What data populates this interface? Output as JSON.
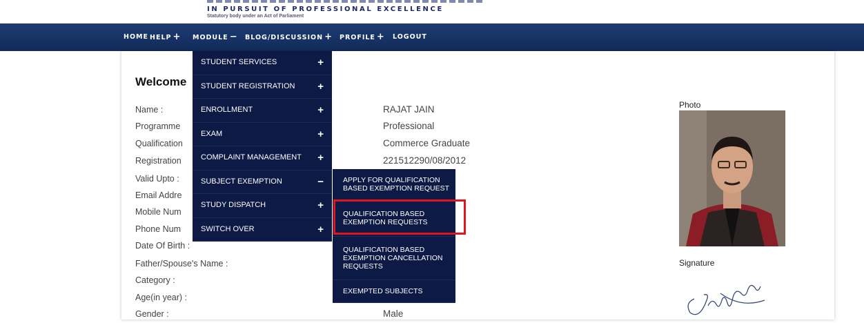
{
  "header": {
    "tagline": "IN PURSUIT OF PROFESSIONAL EXCELLENCE",
    "subtagline": "Statutory body under an Act of Parliament"
  },
  "nav": {
    "items": [
      {
        "label": "HOME",
        "sign": ""
      },
      {
        "label": "HELP",
        "sign": "+"
      },
      {
        "label": "MODULE",
        "sign": "−"
      },
      {
        "label": "BLOG/DISCUSSION",
        "sign": "+"
      },
      {
        "label": "PROFILE",
        "sign": "+"
      },
      {
        "label": "LOGOUT",
        "sign": ""
      }
    ]
  },
  "welcome": "Welcome",
  "fields": [
    {
      "label": "Name :",
      "value": "RAJAT JAIN"
    },
    {
      "label": "Programme",
      "value": "Professional"
    },
    {
      "label": "Qualification",
      "value": "Commerce Graduate"
    },
    {
      "label": "Registration",
      "value": "221512290/08/2012"
    },
    {
      "label": "Valid Upto :",
      "value": ""
    },
    {
      "label": "Email Addre",
      "value": ""
    },
    {
      "label": "Mobile Num",
      "value": ""
    },
    {
      "label": "Phone Num",
      "value": ""
    },
    {
      "label": "Date Of Birth :",
      "value": ""
    },
    {
      "label": "Father/Spouse's Name :",
      "value": ""
    },
    {
      "label": "Category :",
      "value": ""
    },
    {
      "label": "Age(in year) :",
      "value": ""
    },
    {
      "label": "Gender :",
      "value": "Male"
    }
  ],
  "photo_label": "Photo",
  "signature_label": "Signature",
  "module_menu": [
    {
      "label": "STUDENT SERVICES",
      "sign": "+"
    },
    {
      "label": "STUDENT REGISTRATION",
      "sign": "+"
    },
    {
      "label": "ENROLLMENT",
      "sign": "+"
    },
    {
      "label": "EXAM",
      "sign": "+"
    },
    {
      "label": "COMPLAINT MANAGEMENT",
      "sign": "+"
    },
    {
      "label": "SUBJECT EXEMPTION",
      "sign": "−"
    },
    {
      "label": "STUDY DISPATCH",
      "sign": "+"
    },
    {
      "label": "SWITCH OVER",
      "sign": "+"
    }
  ],
  "subject_exemption_menu": [
    {
      "label": "APPLY FOR QUALIFICATION BASED EXEMPTION REQUEST"
    },
    {
      "label": "QUALIFICATION BASED EXEMPTION REQUESTS"
    },
    {
      "label": "QUALIFICATION BASED EXEMPTION CANCELLATION REQUESTS"
    },
    {
      "label": "EXEMPTED SUBJECTS"
    }
  ],
  "colors": {
    "navbar": "#1e3d74",
    "menu_bg": "#0c1a45",
    "highlight": "#e0151e"
  }
}
